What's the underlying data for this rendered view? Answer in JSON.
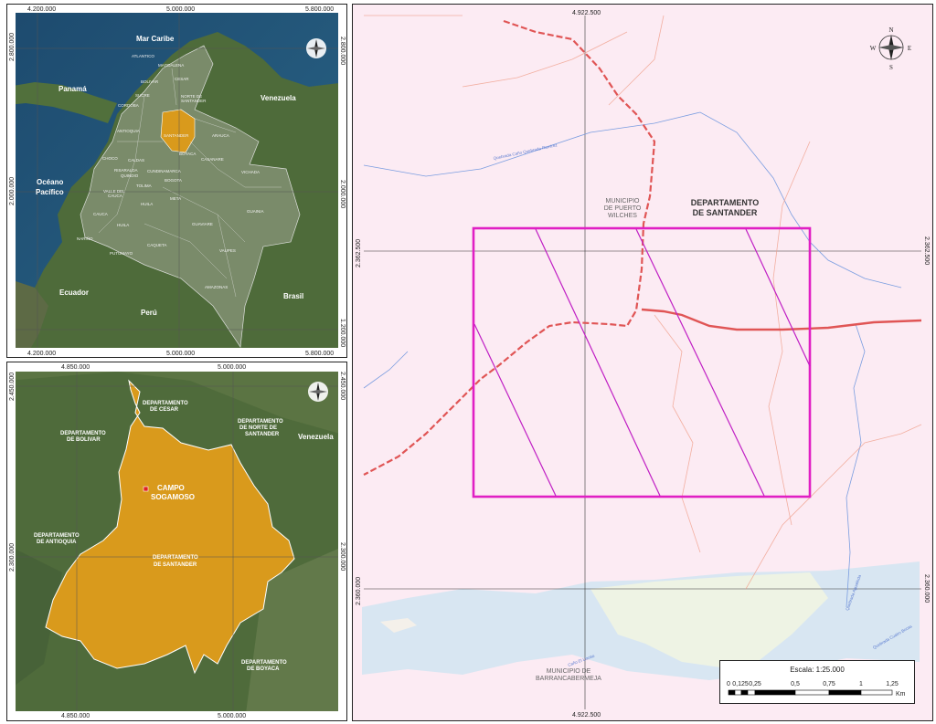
{
  "panel_country": {
    "ticks_top": [
      "4.200.000",
      "5.000.000",
      "5.800.000"
    ],
    "ticks_bottom": [
      "4.200.000",
      "5.000.000",
      "5.800.000"
    ],
    "ticks_left": [
      "2.800.000",
      "2.000.000"
    ],
    "ticks_right": [
      "2.800.000",
      "2.000.000",
      "1.200.000"
    ],
    "countries": {
      "mar": "Mar Caribe",
      "panama": "Panamá",
      "venezuela": "Venezuela",
      "oceano1": "Océano",
      "oceano2": "Pacífico",
      "ecuador": "Ecuador",
      "peru": "Perú",
      "brasil": "Brasil"
    },
    "departments": [
      "ATLANTICO",
      "MAGDALENA",
      "CESAR",
      "BOLIVAR",
      "SUCRE",
      "CORDOBA",
      "NORTE DE",
      "SANTANDER",
      "ANTIOQUIA",
      "SANTANDER",
      "ARAUCA",
      "BOYACA",
      "CHOCO",
      "CALDAS",
      "RISARALDA",
      "QUINDIO",
      "CUNDINAMARCA",
      "CASANARE",
      "VICHADA",
      "TOLIMA",
      "VALLE DEL",
      "CAUCA",
      "HUILA",
      "META",
      "BOGOTA",
      "CAUCA",
      "NARIÑO",
      "HUILA",
      "GUAINIA",
      "GUAVIARE",
      "PUTUMAYO",
      "CAQUETA",
      "VAUPES",
      "AMAZONAS"
    ]
  },
  "panel_region": {
    "ticks_top": [
      "4.850.000",
      "5.000.000"
    ],
    "ticks_bottom": [
      "4.850.000",
      "5.000.000"
    ],
    "ticks_left": [
      "2.450.000",
      "2.300.000"
    ],
    "ticks_right": [
      "2.450.000",
      "2.300.000"
    ],
    "labels": {
      "cesar1": "DEPARTAMENTO",
      "cesar2": "DE CESAR",
      "bolivar1": "DEPARTAMENTO",
      "bolivar2": "DE BOLIVAR",
      "norte1": "DEPARTAMENTO",
      "norte2": "DE NORTE DE",
      "norte3": "SANTANDER",
      "venezuela": "Venezuela",
      "campo1": "CAMPO",
      "campo2": "SOGAMOSO",
      "antioquia1": "DEPARTAMENTO",
      "antioquia2": "DE ANTIOQUIA",
      "santander1": "DEPARTAMENTO",
      "santander2": "DE SANTANDER",
      "boyaca1": "DEPARTAMENTO",
      "boyaca2": "DE BOYACA"
    }
  },
  "panel_detail": {
    "tick_top": "4.922.500",
    "tick_bottom": "4.922.500",
    "tick_left_1": "2.362.500",
    "tick_left_2": "2.360.000",
    "tick_right_1": "2.362.500",
    "tick_right_2": "2.360.000",
    "municipio1": "MUNICIPIO",
    "municipio2": "DE PUERTO",
    "municipio3": "WILCHES",
    "depto1": "DEPARTAMENTO",
    "depto2": "DE SANTANDER",
    "barranca1": "MUNICIPIO DE",
    "barranca2": "BARRANCABERMEJA",
    "quebrada1": "Quebrada Caño Quebrada Ramirez",
    "quebrada2": "Caño El Llanito",
    "quebrada3": "Quebrada Agualinda",
    "quebrada4": "Quebrada Cuatro Bocas",
    "compass": {
      "n": "N",
      "s": "S",
      "e": "E",
      "w": "W"
    }
  },
  "scale": {
    "title": "Escala:  1:25.000",
    "labels": [
      "0",
      "0,125",
      "0,25",
      "0,5",
      "0,75",
      "1",
      "1,25"
    ],
    "unit": "Km"
  },
  "colors": {
    "study_area": "#e01fc4",
    "santander": "#d99a1c",
    "road": "#e05555",
    "river": "#7a9de0",
    "water": "#d8e6f2"
  }
}
